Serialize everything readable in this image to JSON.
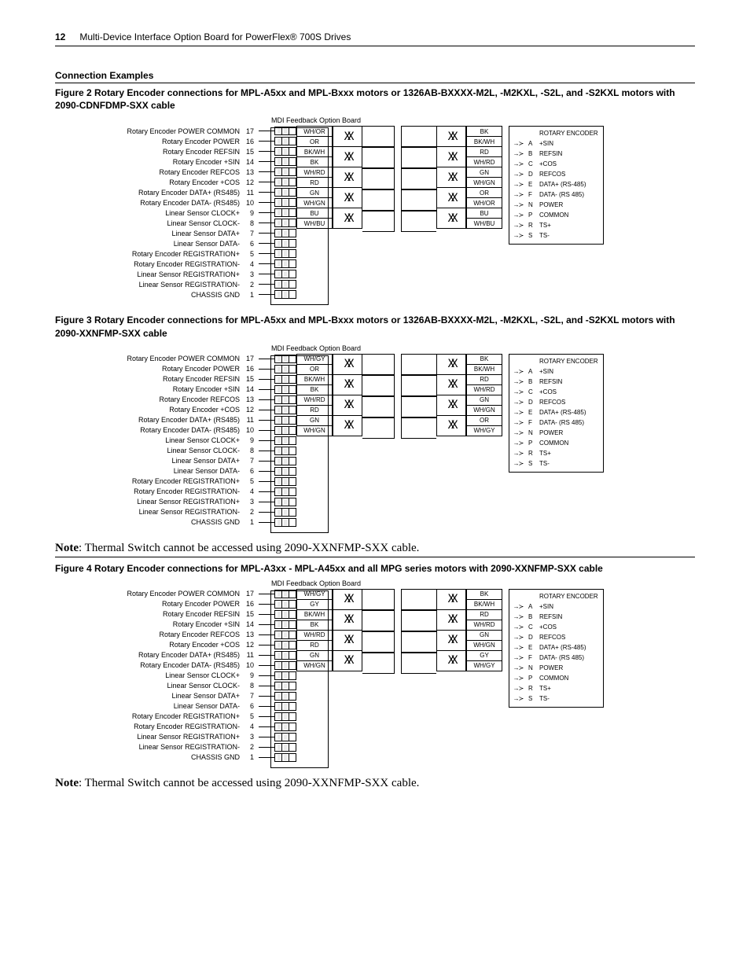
{
  "header": {
    "page": "12",
    "title": "Multi-Device Interface Option Board for PowerFlex® 700S Drives"
  },
  "section_title": "Connection Examples",
  "figures": {
    "f2": "Figure 2   Rotary Encoder connections for MPL-A5xx and MPL-Bxxx motors or 1326AB-BXXXX-M2L, -M2KXL, -S2L, and -S2KXL motors with 2090-CDNFDMP-SXX cable",
    "f3": "Figure 3   Rotary Encoder connections for MPL-A5xx and MPL-Bxxx motors or 1326AB-BXXXX-M2L, -M2KXL, -S2L, and -S2KXL motors with 2090-XXNFMP-SXX cable",
    "f4": "Figure 4   Rotary Encoder connections for MPL-A3xx - MPL-A45xx and all MPG series motors with 2090-XXNFMP-SXX cable"
  },
  "note": "Thermal Switch cannot be accessed using 2090-XXNFMP-SXX cable.",
  "note_prefix": "Note",
  "mdi_title": "MDI Feedback Option Board",
  "pins": [
    {
      "n": "17",
      "l": "Rotary Encoder POWER COMMON"
    },
    {
      "n": "16",
      "l": "Rotary Encoder POWER"
    },
    {
      "n": "15",
      "l": "Rotary Encoder REFSIN"
    },
    {
      "n": "14",
      "l": "Rotary Encoder +SIN"
    },
    {
      "n": "13",
      "l": "Rotary Encoder REFCOS"
    },
    {
      "n": "12",
      "l": "Rotary Encoder +COS"
    },
    {
      "n": "11",
      "l": "Rotary Encoder DATA+ (RS485)"
    },
    {
      "n": "10",
      "l": "Rotary Encoder DATA- (RS485)"
    },
    {
      "n": "9",
      "l": "Linear Sensor CLOCK+"
    },
    {
      "n": "8",
      "l": "Linear Sensor CLOCK-"
    },
    {
      "n": "7",
      "l": "Linear Sensor DATA+"
    },
    {
      "n": "6",
      "l": "Linear Sensor DATA-"
    },
    {
      "n": "5",
      "l": "Rotary Encoder REGISTRATION+"
    },
    {
      "n": "4",
      "l": "Rotary Encoder REGISTRATION-"
    },
    {
      "n": "3",
      "l": "Linear Sensor REGISTRATION+"
    },
    {
      "n": "2",
      "l": "Linear Sensor REGISTRATION-"
    },
    {
      "n": "1",
      "l": "CHASSIS GND"
    }
  ],
  "wires_f2_left": [
    "WH/OR",
    "OR",
    "BK/WH",
    "BK",
    "WH/RD",
    "RD",
    "GN",
    "WH/GN",
    "BU",
    "WH/BU"
  ],
  "wires_f2_right": [
    "BK",
    "BK/WH",
    "RD",
    "WH/RD",
    "GN",
    "WH/GN",
    "OR",
    "WH/OR",
    "BU",
    "WH/BU"
  ],
  "wires_f3_left": [
    "WH/GY",
    "OR",
    "BK/WH",
    "BK",
    "WH/RD",
    "RD",
    "GN",
    "WH/GN"
  ],
  "wires_f3_right": [
    "BK",
    "BK/WH",
    "RD",
    "WH/RD",
    "GN",
    "WH/GN",
    "OR",
    "WH/GY"
  ],
  "wires_f4_left": [
    "WH/GY",
    "GY",
    "BK/WH",
    "BK",
    "WH/RD",
    "RD",
    "GN",
    "WH/GN"
  ],
  "wires_f4_right": [
    "BK",
    "BK/WH",
    "RD",
    "WH/RD",
    "GN",
    "WH/GN",
    "GY",
    "WH/GY"
  ],
  "encoder_title": "ROTARY ENCODER",
  "encoder": [
    {
      "p": "A",
      "l": "+SIN"
    },
    {
      "p": "B",
      "l": "REFSIN"
    },
    {
      "p": "C",
      "l": "+COS"
    },
    {
      "p": "D",
      "l": "REFCOS"
    },
    {
      "p": "E",
      "l": "DATA+ (RS-485)"
    },
    {
      "p": "F",
      "l": "DATA- (RS 485)"
    },
    {
      "p": "N",
      "l": "POWER"
    },
    {
      "p": "P",
      "l": "COMMON"
    },
    {
      "p": "R",
      "l": "TS+"
    },
    {
      "p": "S",
      "l": "TS-"
    }
  ]
}
